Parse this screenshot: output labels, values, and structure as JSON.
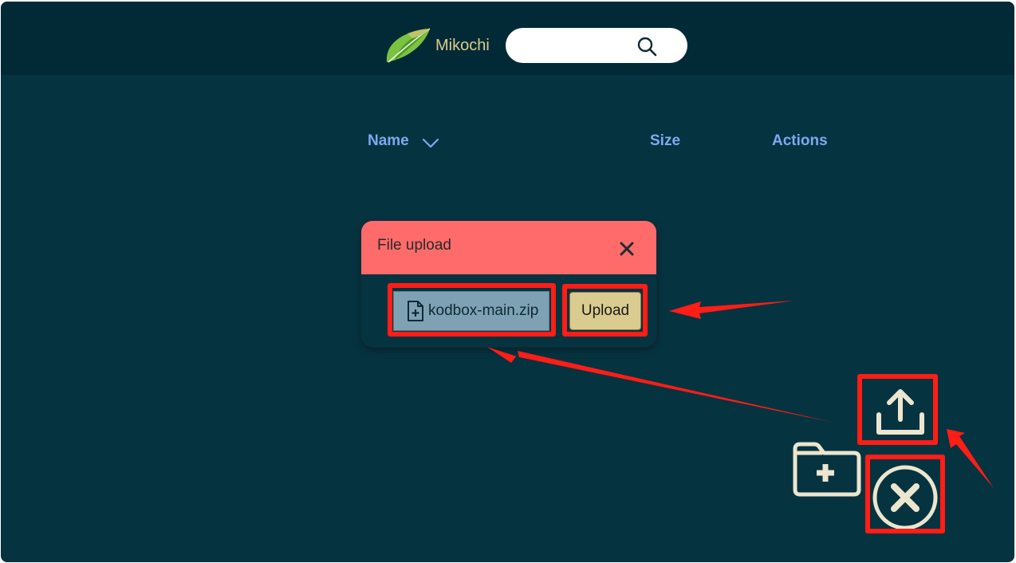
{
  "header": {
    "brand": "Mikochi",
    "search": {
      "value": "",
      "placeholder": ""
    }
  },
  "table": {
    "columns": [
      {
        "label": "Name"
      },
      {
        "label": "Size"
      },
      {
        "label": "Actions"
      }
    ]
  },
  "upload_dialog": {
    "title": "File upload",
    "file_name": "kodbox-main.zip",
    "upload_label": "Upload"
  },
  "icons": {
    "logo": "leaf-logo-icon",
    "search": "search-icon",
    "sort": "chevron-down-icon",
    "close": "close-icon",
    "file": "file-add-icon",
    "upload": "upload-icon",
    "new_folder": "folder-add-icon",
    "fab_close": "circle-close-icon"
  },
  "colors": {
    "background": "#063340",
    "header": "#022a36",
    "brand": "#dacb8f",
    "column_header": "#7fa8f0",
    "dialog_header": "#ff6b6b",
    "upload_button": "#dacb8f",
    "file_box": "#7ea1b4",
    "fab": "#ece6cf",
    "annotation": "#ff1d16"
  }
}
